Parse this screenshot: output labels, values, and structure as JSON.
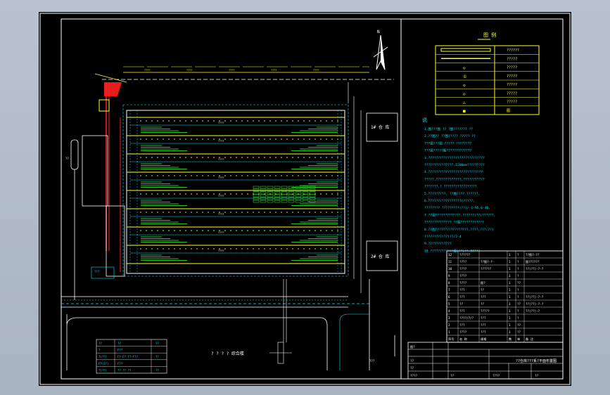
{
  "legend_header": "图 例",
  "legend_rows": [
    {
      "left": "",
      "right": "??????"
    },
    {
      "left": "",
      "right": "?????"
    },
    {
      "left": "◇",
      "right": "?????"
    },
    {
      "left": "①",
      "right": "?????"
    },
    {
      "left": "◇",
      "right": "?????"
    },
    {
      "left": "◇",
      "right": "?????"
    },
    {
      "left": "△",
      "right": "?????"
    },
    {
      "left": "■",
      "right": "图"
    }
  ],
  "notes_title": "说",
  "notes_lines": [
    "1.图???图 ?? ?图??????? ??",
    "2.??图?? ??图????? ????? ??",
    "  ???图???图 ????? ????????",
    "  ???图?????图?????????????",
    "3.?????????????????????????????",
    "  ???????????????,1200mm?????????",
    "4.????????????????????????????",
    "  ?????,?????????????,???????????",
    "  ???????,? ?????????????????",
    "5.?????????, ??图???? ??????,",
    "6.?????????????????(??)??,",
    "  ????????  ?????????(??)/-1-95,6-46,",
    "7.??图?????????????,??????(??)??????,",
    "  ?????????????? ??图????????????",
    "8.??图?????????????????,????,???(??)",
    "  ?????????(??)??/2-4",
    "9.????????????",
    "10.????????????图(??)??-97???"
  ],
  "warehouse_top": "1# 仓 库",
  "warehouse_bottom": "2# 仓 库",
  "building_label": "? ? ? ?  综合楼",
  "north_label": "N",
  "left_legend_table": [
    [
      "??",
      "??",
      "??"
    ],
    [
      "?",
      "F??",
      ""
    ],
    [
      "?(??)",
      "F?-F?  F?-F??",
      "??"
    ],
    [
      "F?(??)",
      "F??",
      ""
    ],
    [
      "?(??)",
      "?? ?? ??",
      "??"
    ]
  ],
  "bom_rows": [
    [
      "12",
      "??????",
      "",
      "1",
      "?",
      "??图?-??"
    ],
    [
      "11",
      "????",
      "??图?-?",
      "1",
      "?",
      "图??????"
    ],
    [
      "10",
      "????",
      "??????",
      "1",
      "?",
      "??(??)-?-?"
    ],
    [
      "9",
      "????",
      "",
      "1",
      "?",
      ""
    ],
    [
      "8",
      "????",
      "图?",
      "1",
      "??",
      ""
    ],
    [
      "7",
      "???",
      "??",
      "1",
      "?",
      ""
    ],
    [
      "6",
      "???",
      "???",
      "1",
      "?",
      "??(??)-?-?"
    ],
    [
      "5",
      "??",
      "??",
      "1",
      "??",
      "??(??)-?-?"
    ],
    [
      "4",
      "???",
      "?????",
      "1",
      "?",
      "??(??)-?"
    ],
    [
      "3",
      "????/?/?",
      "???",
      "1",
      "?",
      ""
    ],
    [
      "2",
      "???",
      "???",
      "1",
      "??",
      ""
    ],
    [
      "1",
      "????",
      "???",
      "1",
      "??",
      ""
    ]
  ],
  "bom_header": [
    "序号",
    "名 称",
    "规格",
    "数",
    "单",
    "备 注"
  ],
  "title_main": "??仓库???系?平面布置图",
  "title_fields": [
    "图?",
    "??",
    "??",
    "????",
    "??",
    "????",
    "??"
  ],
  "dim_labels": [
    "????",
    "????",
    "????",
    "????",
    "????"
  ],
  "row_labels": [
    "????",
    "????",
    "????",
    "????",
    "????",
    "????",
    "????",
    "????"
  ],
  "small_labels": [
    "???",
    "??",
    "???"
  ],
  "colors": {
    "frame": "#ffffff",
    "cyan": "#00e5ff",
    "yellow": "#ffff33",
    "green": "#33ff33",
    "red": "#ff2020"
  }
}
